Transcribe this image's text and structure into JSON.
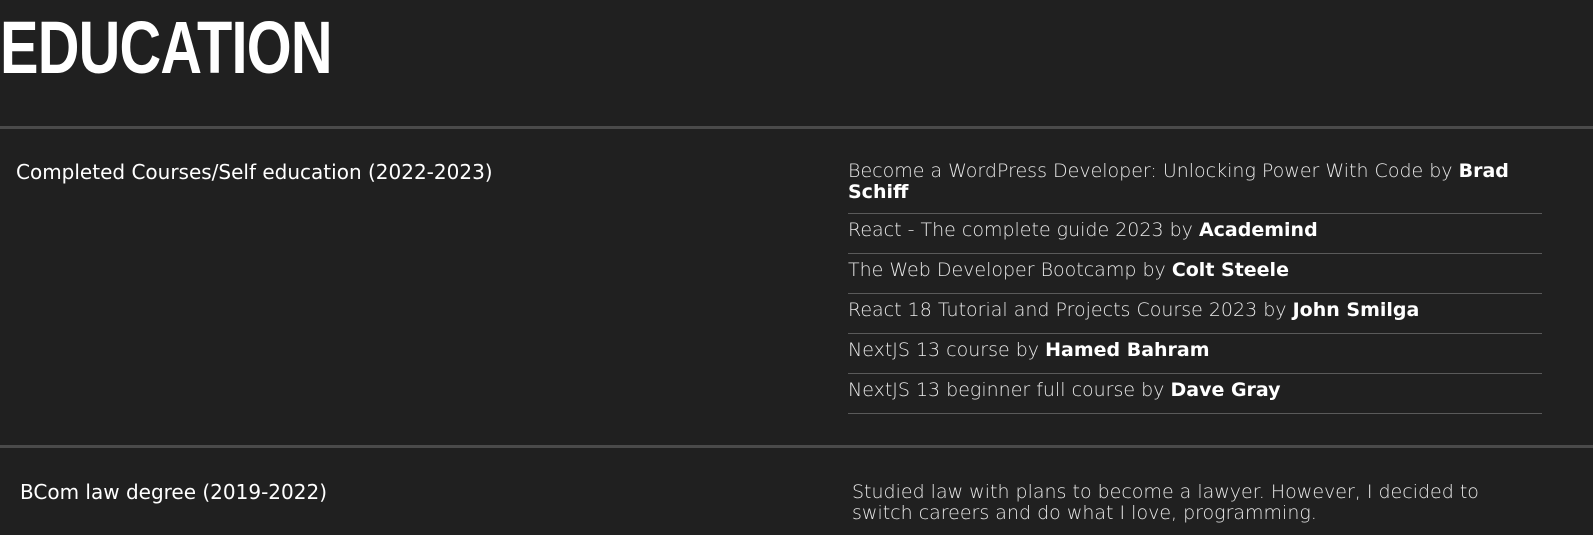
{
  "header": {
    "title": "EDUCATION"
  },
  "sections": [
    {
      "label": "Completed Courses/Self education (2022-2023)",
      "courses": [
        {
          "title": "Become a WordPress Developer: Unlocking Power With Code",
          "by": "by",
          "author": "Brad Schiff"
        },
        {
          "title": "React - The complete guide 2023",
          "by": "by",
          "author": "Academind"
        },
        {
          "title": "The Web Developer Bootcamp",
          "by": "by",
          "author": "Colt Steele"
        },
        {
          "title": "React 18 Tutorial and Projects Course 2023",
          "by": "by",
          "author": "John Smilga"
        },
        {
          "title": "NextJS 13 course",
          "by": "by",
          "author": "Hamed Bahram"
        },
        {
          "title": "NextJS 13 beginner full course",
          "by": "by",
          "author": "Dave Gray"
        }
      ]
    },
    {
      "label": "BCom law degree (2019-2022)",
      "description": "Studied law with plans to become a lawyer. However, I decided to switch careers and do what I love, programming."
    }
  ],
  "colors": {
    "background": "#202020",
    "divider": "#4a4a4a",
    "text": "#ffffff"
  }
}
